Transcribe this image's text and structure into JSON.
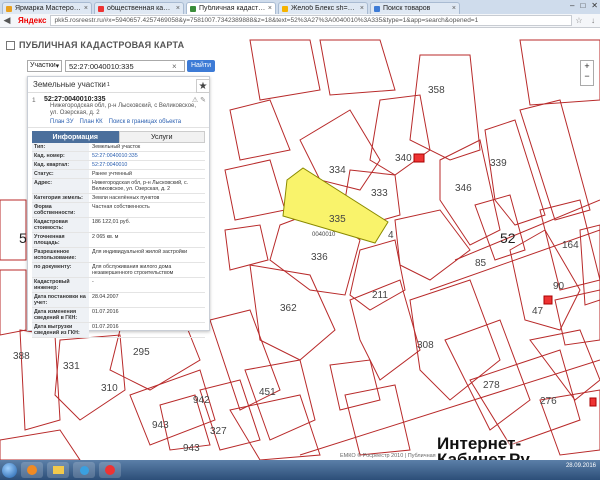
{
  "browser": {
    "tabs": [
      {
        "title": "Ярмарка Мастеров - ручн...",
        "active": false,
        "color": "#e8a020"
      },
      {
        "title": "общественная кадастрова...",
        "active": false,
        "color": "#e33"
      },
      {
        "title": "Публичная кадастровая к...",
        "active": true,
        "color": "#3a8d3a"
      },
      {
        "title": "Желоб Блекс sh=25 мм, 457...",
        "active": false,
        "color": "#f6b300"
      },
      {
        "title": "Поиск товаров",
        "active": false,
        "color": "#3d7bd6"
      }
    ],
    "logo": "Яндекс",
    "url": "pkk5.rosreestr.ru/#x=5940657.4257469058&y=7581007.7342389888&z=18&text=52%3A27%3A0040010%3A335&type=1&app=search&opened=1"
  },
  "map": {
    "title": "ПУБЛИЧНАЯ КАДАСТРОВАЯ КАРТА",
    "search": {
      "type_label": "Участки",
      "value": "52:27:0040010:335",
      "find_label": "Найти"
    },
    "parcel_labels": [
      "358",
      "334",
      "340",
      "333",
      "346",
      "339",
      "335",
      "336",
      "52",
      "5",
      "211",
      "362",
      "4",
      "295",
      "310",
      "942",
      "327",
      "451",
      "943",
      "943",
      "388",
      "331",
      "308",
      "278",
      "276",
      "164",
      "90",
      "85",
      "47",
      "0040010"
    ],
    "footer": "ЕМКО © Росреестр 2010 | Публичная"
  },
  "panel": {
    "header": "Земельные участки",
    "count": "1",
    "item_num": "1",
    "cad_number": "52:27:0040010:335",
    "address": "Нижегородская обл, р-н Лысковский, с Великовское, ул. Озерская, д. 2",
    "links": [
      "План ЗУ",
      "План КК",
      "Поиск в границах объекта"
    ],
    "tabs": [
      "Информация",
      "Услуги"
    ],
    "rows": [
      {
        "k": "Тип:",
        "v": "Земельный участок",
        "link": false
      },
      {
        "k": "Кад. номер:",
        "v": "52:27:0040010:335",
        "link": true
      },
      {
        "k": "Кад. квартал:",
        "v": "52:27:0040010",
        "link": true
      },
      {
        "k": "Статус:",
        "v": "Ранее учтенный",
        "link": false
      },
      {
        "k": "Адрес:",
        "v": "Нижегородская обл, р-н Лысковский, с. Великовское, ул. Озерская, д. 2",
        "link": false
      },
      {
        "k": "Категория земель:",
        "v": "Земли населённых пунктов",
        "link": false
      },
      {
        "k": "Форма собственности:",
        "v": "Частная собственность",
        "link": false
      },
      {
        "k": "Кадастровая стоимость:",
        "v": "186 122,01 руб.",
        "link": false
      },
      {
        "k": "Уточненная площадь:",
        "v": "2 065 кв. м",
        "link": false
      },
      {
        "k": "Разрешенное использование:",
        "v": "Для индивидуальной жилой застройки",
        "link": false
      },
      {
        "k": "по документу:",
        "v": "Для обслуживания жилого дома незавершенного строительством",
        "link": false
      },
      {
        "k": "Кадастровый инженер:",
        "v": "-",
        "link": false
      },
      {
        "k": "Дата постановки на учет:",
        "v": "28.04.2007",
        "link": false
      },
      {
        "k": "Дата изменения сведений в ГКН:",
        "v": "01.07.2016",
        "link": false
      },
      {
        "k": "Дата выгрузки сведений из ГКН:",
        "v": "01.07.2016",
        "link": false
      }
    ]
  },
  "watermark": {
    "line1": "Интернет-",
    "line2": "Кабинет.Ру"
  },
  "clock": {
    "time": "",
    "date": "28.09.2016"
  }
}
